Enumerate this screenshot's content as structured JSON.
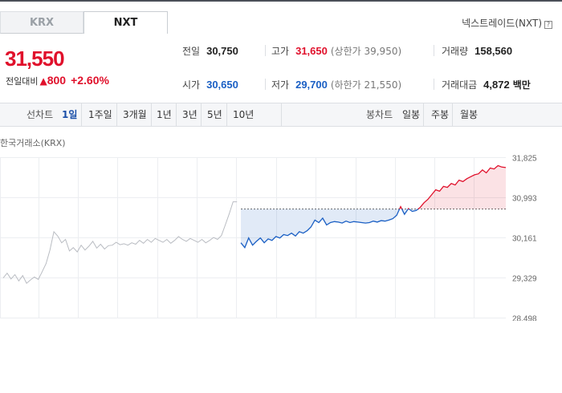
{
  "tabs": [
    {
      "label": "KRX",
      "active": false
    },
    {
      "label": "NXT",
      "active": true
    }
  ],
  "market_link": {
    "label": "넥스트레이드(NXT)",
    "help": "?"
  },
  "price": {
    "current": "31,550",
    "change_label": "전일대비",
    "change_symbol": "▲",
    "change_amount": "800",
    "change_pct": "+2.60%"
  },
  "stats": {
    "prev_close": {
      "label": "전일",
      "value": "30,750"
    },
    "high": {
      "label": "고가",
      "value": "31,650",
      "extra": "(상한가 39,950)"
    },
    "volume": {
      "label": "거래량",
      "value": "158,560"
    },
    "open": {
      "label": "시가",
      "value": "30,650"
    },
    "low": {
      "label": "저가",
      "value": "29,700",
      "extra": "(하한가 21,550)"
    },
    "amount": {
      "label": "거래대금",
      "value": "4,872",
      "unit": "백만"
    }
  },
  "toolbar": {
    "line_chart_label": "선차트",
    "line_periods": [
      "1일",
      "1주일",
      "3개월",
      "1년",
      "3년",
      "5년",
      "10년"
    ],
    "active_period": "1일",
    "candle_chart_label": "봉차트",
    "candle_periods": [
      "일봉",
      "주봉",
      "월봉"
    ]
  },
  "colors": {
    "up": "#e0102b",
    "down": "#1a5fc4",
    "accent": "#1a4fa8"
  },
  "chart_data": {
    "type": "line",
    "source_label": "한국거래소(KRX)",
    "y_ticks": [
      "31,825",
      "30,993",
      "30,161",
      "29,329",
      "28,498"
    ],
    "ylim": [
      28498,
      31825
    ],
    "reference_value": 30750,
    "series": [
      {
        "market": "KRX",
        "points": [
          [
            0,
            29320
          ],
          [
            1,
            29420
          ],
          [
            2,
            29300
          ],
          [
            3,
            29390
          ],
          [
            4,
            29260
          ],
          [
            5,
            29370
          ],
          [
            6,
            29210
          ],
          [
            7,
            29280
          ],
          [
            8,
            29340
          ],
          [
            9,
            29290
          ],
          [
            10,
            29450
          ],
          [
            11,
            29620
          ],
          [
            12,
            29900
          ],
          [
            13,
            30280
          ],
          [
            14,
            30190
          ],
          [
            15,
            30050
          ],
          [
            16,
            30120
          ],
          [
            17,
            29880
          ],
          [
            18,
            29950
          ],
          [
            19,
            29860
          ],
          [
            20,
            30000
          ],
          [
            21,
            29900
          ],
          [
            22,
            29980
          ],
          [
            23,
            30080
          ],
          [
            24,
            29940
          ],
          [
            25,
            30020
          ],
          [
            26,
            29920
          ],
          [
            27,
            29990
          ],
          [
            28,
            30000
          ],
          [
            29,
            30060
          ],
          [
            30,
            30010
          ],
          [
            31,
            30030
          ],
          [
            32,
            30000
          ],
          [
            33,
            30050
          ],
          [
            34,
            30020
          ],
          [
            35,
            30100
          ],
          [
            36,
            30040
          ],
          [
            37,
            30120
          ],
          [
            38,
            30060
          ],
          [
            39,
            30140
          ],
          [
            40,
            30100
          ],
          [
            41,
            30060
          ],
          [
            42,
            30120
          ],
          [
            43,
            30040
          ],
          [
            44,
            30100
          ],
          [
            45,
            30180
          ],
          [
            46,
            30120
          ],
          [
            47,
            30080
          ],
          [
            48,
            30140
          ],
          [
            49,
            30100
          ],
          [
            50,
            30060
          ],
          [
            51,
            30120
          ],
          [
            52,
            30050
          ],
          [
            53,
            30100
          ],
          [
            54,
            30160
          ],
          [
            55,
            30120
          ],
          [
            56,
            30200
          ],
          [
            57,
            30420
          ],
          [
            58,
            30650
          ],
          [
            59,
            30900
          ],
          [
            60,
            30900
          ]
        ]
      },
      {
        "market": "NXT",
        "points": [
          [
            61,
            30050
          ],
          [
            62,
            29950
          ],
          [
            63,
            30150
          ],
          [
            64,
            30000
          ],
          [
            65,
            30080
          ],
          [
            66,
            30150
          ],
          [
            67,
            30050
          ],
          [
            68,
            30130
          ],
          [
            69,
            30100
          ],
          [
            70,
            30180
          ],
          [
            71,
            30150
          ],
          [
            72,
            30220
          ],
          [
            73,
            30200
          ],
          [
            74,
            30250
          ],
          [
            75,
            30190
          ],
          [
            76,
            30280
          ],
          [
            77,
            30250
          ],
          [
            78,
            30300
          ],
          [
            79,
            30380
          ],
          [
            80,
            30520
          ],
          [
            81,
            30470
          ],
          [
            82,
            30560
          ],
          [
            83,
            30420
          ],
          [
            84,
            30470
          ],
          [
            85,
            30490
          ],
          [
            86,
            30480
          ],
          [
            87,
            30460
          ],
          [
            88,
            30500
          ],
          [
            89,
            30470
          ],
          [
            90,
            30490
          ],
          [
            91,
            30480
          ],
          [
            92,
            30470
          ],
          [
            93,
            30460
          ],
          [
            94,
            30470
          ],
          [
            95,
            30500
          ],
          [
            96,
            30480
          ],
          [
            97,
            30510
          ],
          [
            98,
            30500
          ],
          [
            99,
            30520
          ],
          [
            100,
            30550
          ],
          [
            101,
            30620
          ],
          [
            102,
            30800
          ],
          [
            103,
            30640
          ],
          [
            104,
            30760
          ],
          [
            105,
            30700
          ],
          [
            106,
            30720
          ],
          [
            107,
            30780
          ],
          [
            108,
            30880
          ],
          [
            109,
            30950
          ],
          [
            110,
            31050
          ],
          [
            111,
            31150
          ],
          [
            112,
            31120
          ],
          [
            113,
            31220
          ],
          [
            114,
            31200
          ],
          [
            115,
            31280
          ],
          [
            116,
            31250
          ],
          [
            117,
            31350
          ],
          [
            118,
            31320
          ],
          [
            119,
            31380
          ],
          [
            120,
            31420
          ],
          [
            121,
            31460
          ],
          [
            122,
            31480
          ],
          [
            123,
            31560
          ],
          [
            124,
            31500
          ],
          [
            125,
            31600
          ],
          [
            126,
            31580
          ],
          [
            127,
            31650
          ],
          [
            128,
            31620
          ],
          [
            129,
            31610
          ]
        ]
      }
    ]
  }
}
